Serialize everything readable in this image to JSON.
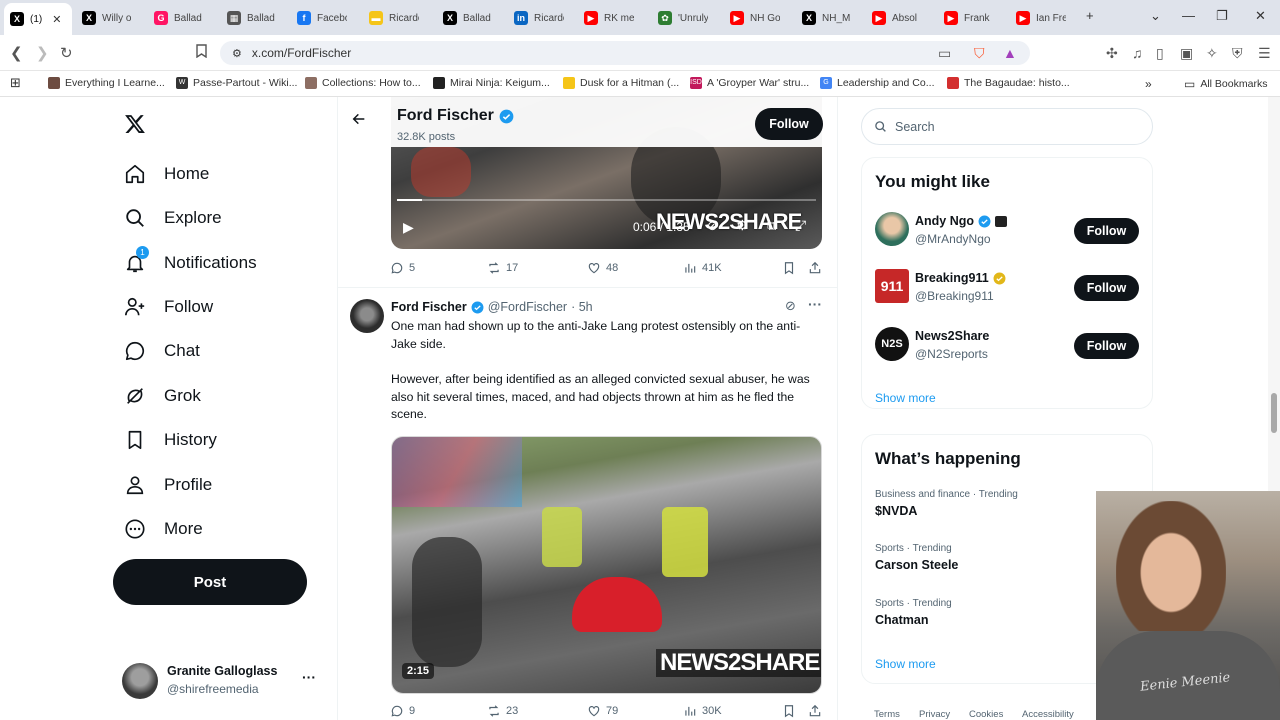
{
  "browser": {
    "tabs": [
      {
        "title": "(1)",
        "icon": "x-icon",
        "color": "#000000",
        "glyph": "X"
      },
      {
        "title": "Willy o",
        "icon": "x-icon",
        "color": "#000000",
        "glyph": "X"
      },
      {
        "title": "Ballad",
        "icon": "genius-icon",
        "color": "#ff1464",
        "glyph": "G"
      },
      {
        "title": "Ballad",
        "icon": "calc-icon",
        "color": "#555555",
        "glyph": "▦"
      },
      {
        "title": "Facebo",
        "icon": "facebook-icon",
        "color": "#1877f2",
        "glyph": "f"
      },
      {
        "title": "Ricardo",
        "icon": "imdb-icon",
        "color": "#f5c518",
        "glyph": "▬"
      },
      {
        "title": "Ballad",
        "icon": "x-icon",
        "color": "#000000",
        "glyph": "X"
      },
      {
        "title": "Ricardo",
        "icon": "linkedin-icon",
        "color": "#0a66c2",
        "glyph": "in"
      },
      {
        "title": "RK me",
        "icon": "youtube-icon",
        "color": "#ff0000",
        "glyph": "▶"
      },
      {
        "title": "'Unruly",
        "icon": "mexico-icon",
        "color": "#2e7d32",
        "glyph": "✿"
      },
      {
        "title": "NH Go",
        "icon": "youtube-icon",
        "color": "#ff0000",
        "glyph": "▶"
      },
      {
        "title": "NH_M",
        "icon": "x-icon",
        "color": "#000000",
        "glyph": "X"
      },
      {
        "title": "Absol",
        "icon": "youtube-icon",
        "color": "#ff0000",
        "glyph": "▶"
      },
      {
        "title": "Frank",
        "icon": "youtube-icon",
        "color": "#ff0000",
        "glyph": "▶"
      },
      {
        "title": "Ian Fre",
        "icon": "youtube-icon",
        "color": "#ff0000",
        "glyph": "▶"
      }
    ],
    "url": "x.com/FordFischer",
    "bookmarks": [
      {
        "label": "Everything I Learne...",
        "color": "#6d4c41"
      },
      {
        "label": "Passe-Partout - Wiki...",
        "color": "#333333",
        "glyph": "W"
      },
      {
        "label": "Collections: How to...",
        "color": "#8d6e63"
      },
      {
        "label": "Mirai Ninja: Keigum...",
        "color": "#222222"
      },
      {
        "label": "Dusk for a Hitman (...",
        "color": "#f5c518"
      },
      {
        "label": "A 'Groyper War' stru...",
        "color": "#c2185b",
        "glyph": "ISD"
      },
      {
        "label": "Leadership and Co...",
        "color": "#4285f4",
        "glyph": "G"
      },
      {
        "label": "The Bagaudae: histo...",
        "color": "#d32f2f"
      }
    ],
    "all_bookmarks": "All Bookmarks"
  },
  "nav": {
    "items": [
      {
        "label": "Home",
        "icon": "home-icon"
      },
      {
        "label": "Explore",
        "icon": "search-icon"
      },
      {
        "label": "Notifications",
        "icon": "bell-icon",
        "badge": "1"
      },
      {
        "label": "Follow",
        "icon": "follow-icon"
      },
      {
        "label": "Chat",
        "icon": "chat-icon"
      },
      {
        "label": "Grok",
        "icon": "grok-icon"
      },
      {
        "label": "History",
        "icon": "bookmark-icon"
      },
      {
        "label": "Profile",
        "icon": "profile-icon"
      },
      {
        "label": "More",
        "icon": "more-circle-icon"
      }
    ],
    "post": "Post",
    "account": {
      "name": "Granite Galloglass",
      "handle": "@shirefreemedia"
    }
  },
  "profile": {
    "name": "Ford Fischer",
    "posts": "32.8K posts",
    "follow": "Follow"
  },
  "tweet1": {
    "time": "0:06 / 1:35",
    "watermark": "NEWS2SHARE",
    "replies": "5",
    "reposts": "17",
    "likes": "48",
    "views": "41K"
  },
  "tweet2": {
    "name": "Ford Fischer",
    "handle": "@FordFischer",
    "age": "· 5h",
    "text1": "One man had shown up to the anti-Jake Lang protest ostensibly on the anti-Jake side.",
    "text2": "However, after being identified as an alleged convicted sexual abuser, he was also hit several times, maced, and had objects thrown at him as he fled the scene.",
    "duration": "2:15",
    "watermark": "NEWS2SHARE",
    "replies": "9",
    "reposts": "23",
    "likes": "79",
    "views": "30K"
  },
  "sidebar": {
    "search_placeholder": "Search",
    "you_might_like": "You might like",
    "suggestions": [
      {
        "name": "Andy Ngo",
        "handle": "@MrAndyNgo",
        "badge": "blue",
        "follow": "Follow"
      },
      {
        "name": "Breaking911",
        "handle": "@Breaking911",
        "badge": "gold",
        "follow": "Follow"
      },
      {
        "name": "News2Share",
        "handle": "@N2Sreports",
        "badge": "none",
        "follow": "Follow"
      }
    ],
    "show_more": "Show more",
    "whats_happening": "What’s happening",
    "trends": [
      {
        "meta": "Business and finance · Trending",
        "topic": "$NVDA"
      },
      {
        "meta": "Sports · Trending",
        "topic": "Carson Steele"
      },
      {
        "meta": "Sports · Trending",
        "topic": "Chatman"
      }
    ],
    "show_more_2": "Show more",
    "footer": [
      "Terms",
      "Privacy",
      "Cookies",
      "Accessibility"
    ]
  },
  "webcam": {
    "shirt_text": "Eenie Meenie"
  }
}
